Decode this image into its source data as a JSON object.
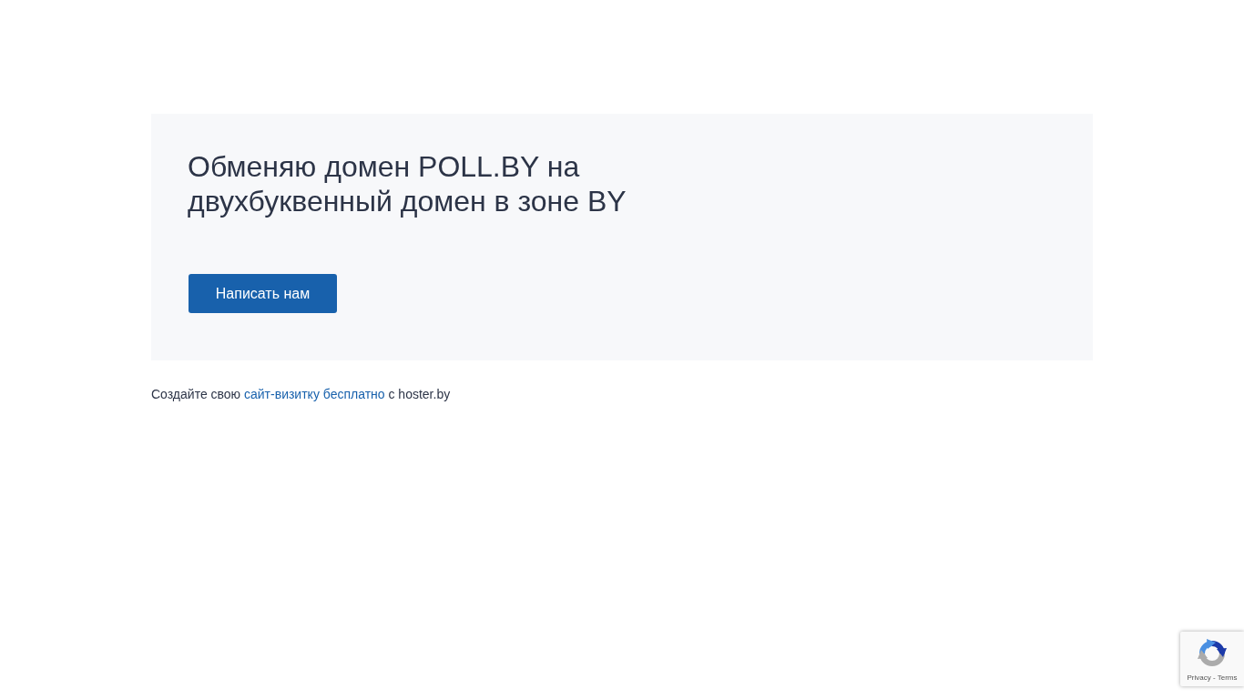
{
  "hero": {
    "title": "Обменяю домен POLL.BY на двухбуквенный домен в зоне BY",
    "button": "Написать нам"
  },
  "footer": {
    "before": "Создайте свою ",
    "link": "сайт-визитку бесплатно",
    "after": " с hoster.by"
  },
  "recaptcha": {
    "links": "Privacy - Terms"
  }
}
